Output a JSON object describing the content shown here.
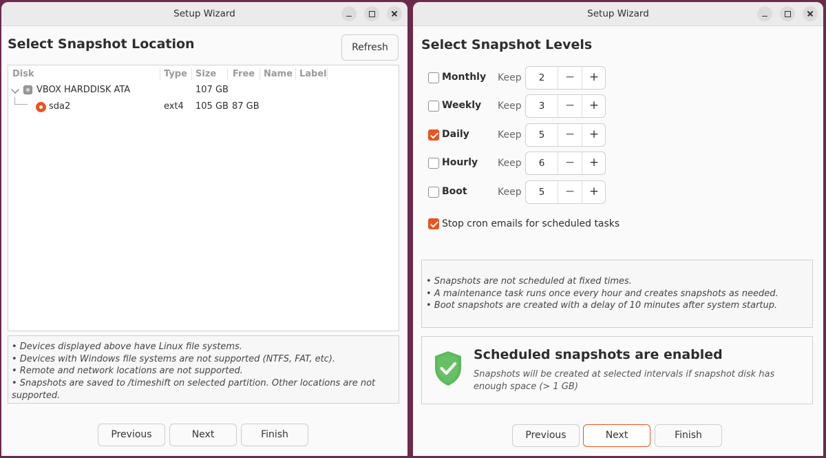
{
  "left_window": {
    "title": "Setup Wizard",
    "heading": "Select Snapshot Location",
    "refresh_label": "Refresh",
    "table": {
      "headers": [
        "Disk",
        "Type",
        "Size",
        "Free",
        "Name",
        "Label"
      ],
      "disk": {
        "name": "VBOX HARDDISK ATA",
        "type": "",
        "size": "107 GB",
        "free": ""
      },
      "partition": {
        "name": "sda2",
        "type": "ext4",
        "size": "105 GB",
        "free": "87 GB",
        "selected": true
      }
    },
    "notes": [
      "• Devices displayed above have Linux file systems.",
      "• Devices with Windows file systems are not supported (NTFS, FAT, etc).",
      "• Remote and network locations are not supported.",
      "• Snapshots are saved to /timeshift on selected partition. Other locations are not",
      "supported."
    ],
    "buttons": {
      "previous": "Previous",
      "next": "Next",
      "finish": "Finish"
    }
  },
  "right_window": {
    "title": "Setup Wizard",
    "heading": "Select Snapshot Levels",
    "keep_label": "Keep",
    "levels": [
      {
        "label": "Monthly",
        "checked": false,
        "keep": "2"
      },
      {
        "label": "Weekly",
        "checked": false,
        "keep": "3"
      },
      {
        "label": "Daily",
        "checked": true,
        "keep": "5"
      },
      {
        "label": "Hourly",
        "checked": false,
        "keep": "6"
      },
      {
        "label": "Boot",
        "checked": false,
        "keep": "5"
      }
    ],
    "stepper_minus": "−",
    "stepper_plus": "+",
    "cron": {
      "label": "Stop cron emails for scheduled tasks",
      "checked": true
    },
    "notes": [
      "• Snapshots are not scheduled at fixed times.",
      "• A maintenance task runs once every hour and creates snapshots as needed.",
      "• Boot snapshots are created with a delay of 10 minutes after system startup."
    ],
    "status": {
      "title": "Scheduled snapshots are enabled",
      "text": "Snapshots will be created at selected intervals if snapshot disk has enough space (> 1 GB)"
    },
    "buttons": {
      "previous": "Previous",
      "next": "Next",
      "finish": "Finish"
    }
  },
  "colors": {
    "accent": "#e95420",
    "shield": "#5cb85c",
    "background": "#6b2a4a"
  },
  "icons": {
    "disk": "harddisk-icon",
    "partition": "radio-selected-icon",
    "status": "shield-check-icon"
  }
}
